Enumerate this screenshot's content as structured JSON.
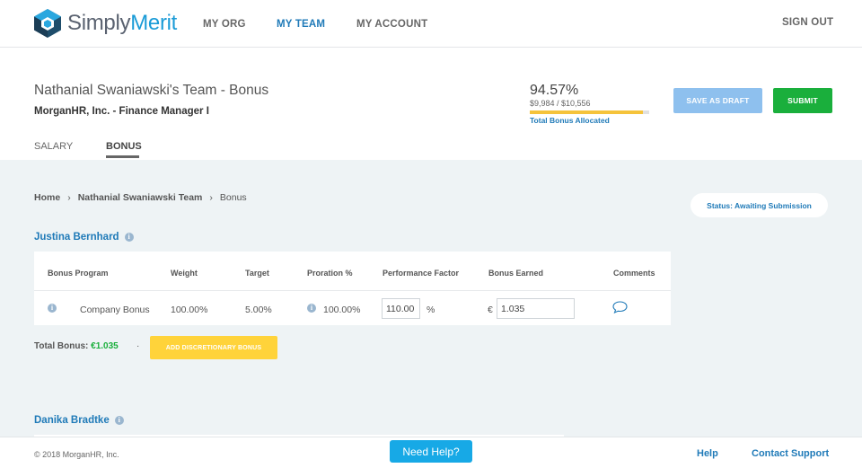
{
  "nav": {
    "logo_part1": "Simply",
    "logo_part2": "Merit",
    "items": [
      "MY ORG",
      "MY TEAM",
      "MY ACCOUNT"
    ],
    "active": "MY TEAM",
    "sign_out": "SIGN OUT"
  },
  "header": {
    "title": "Nathanial Swaniawski's Team - Bonus",
    "subtitle": "MorganHR, Inc. - Finance Manager I",
    "tabs": [
      "SALARY",
      "BONUS"
    ],
    "active_tab": "BONUS",
    "allocation": {
      "percent": "94.57%",
      "amounts": "$9,984 / $10,556",
      "label": "Total Bonus Allocated",
      "fill_fraction": 0.9457,
      "fill_color": "#f5c33b"
    },
    "save_draft_label": "SAVE AS DRAFT",
    "submit_label": "SUBMIT"
  },
  "breadcrumb": [
    "Home",
    "Nathanial Swaniawski Team",
    "Bonus"
  ],
  "breadcrumb_separator": "›",
  "status": "Status: Awaiting Submission",
  "employees": [
    {
      "name": "Justina Bernhard",
      "columns": [
        "Bonus Program",
        "Weight",
        "Target",
        "Proration %",
        "Performance Factor",
        "Bonus Earned",
        "Comments"
      ],
      "rows": [
        {
          "program": "Company Bonus",
          "weight": "100.00%",
          "target": "5.00%",
          "proration": "100.00%",
          "performance_factor": "110.00",
          "performance_unit": "%",
          "currency": "€",
          "bonus_earned": "1.035"
        }
      ],
      "total_label": "Total Bonus:",
      "total_value": "€1.035",
      "add_discretionary_label": "ADD DISCRETIONARY BONUS"
    },
    {
      "name": "Danika Bradtke"
    }
  ],
  "footer": {
    "copyright": "© 2018 MorganHR, Inc.",
    "need_help": "Need Help?",
    "help": "Help",
    "contact": "Contact Support"
  },
  "icons": {
    "logo": "hexagon-cube-logo",
    "info": "info-icon",
    "comment": "speech-bubble-icon"
  }
}
